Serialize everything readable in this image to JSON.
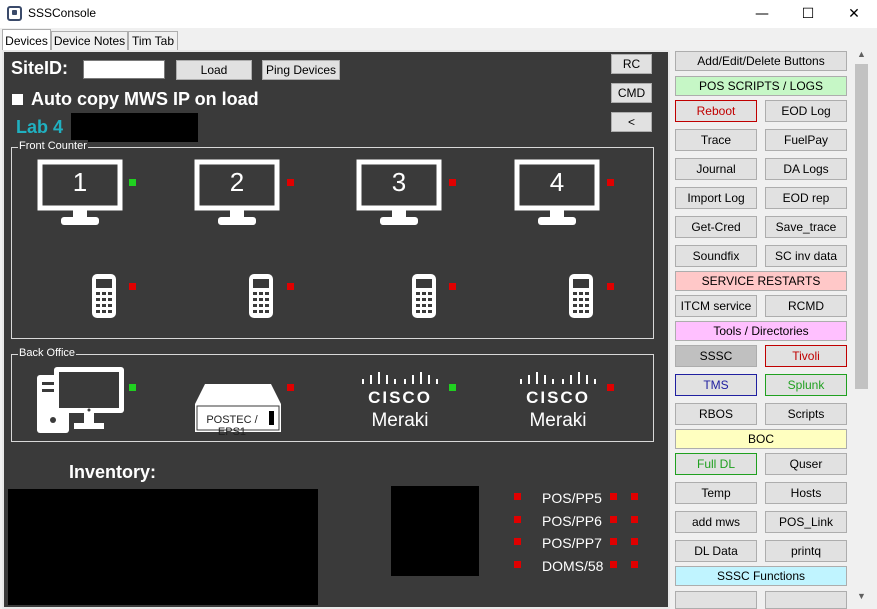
{
  "window": {
    "title": "SSSConsole",
    "minimize": "—",
    "maximize": "☐",
    "close": "✕"
  },
  "tabs": [
    {
      "label": "Devices"
    },
    {
      "label": "Device Notes"
    },
    {
      "label": "Tim Tab"
    }
  ],
  "devices": {
    "siteid_label": "SiteID:",
    "siteid_value": "",
    "load_button": "Load",
    "ping_button": "Ping Devices",
    "rc_button": "RC",
    "cmd_button": "CMD",
    "back_button": "<",
    "autocopy_label": "Auto copy MWS IP on load",
    "lab_label": "Lab 4",
    "front_counter_label": "Front Counter",
    "back_office_label": "Back Office",
    "monitors": [
      {
        "num": "1"
      },
      {
        "num": "2"
      },
      {
        "num": "3"
      },
      {
        "num": "4"
      }
    ],
    "postec_label": "POSTEC / EPS1",
    "cisco_text": "CISCO",
    "meraki_text": "Meraki",
    "inventory_label": "Inventory:",
    "pp_items": [
      {
        "label": "POS/PP5"
      },
      {
        "label": "POS/PP6"
      },
      {
        "label": "POS/PP7"
      },
      {
        "label": "DOMS/58"
      }
    ]
  },
  "colors": {
    "led_red": "#e00000",
    "led_green": "#20d020",
    "lab_cyan": "#20b0c0",
    "panel_dark": "#3a3a3a"
  },
  "right_panel": {
    "add_edit": "Add/Edit/Delete Buttons",
    "pos_scripts": "POS SCRIPTS / LOGS",
    "reboot": "Reboot",
    "eod_log": "EOD Log",
    "trace": "Trace",
    "fuelpay": "FuelPay",
    "journal": "Journal",
    "da_logs": "DA Logs",
    "import_log": "Import Log",
    "eod_rep": "EOD rep",
    "get_cred": "Get-Cred",
    "save_trace": "Save_trace",
    "soundfix": "Soundfix",
    "sc_inv": "SC inv data",
    "service_restarts": "SERVICE RESTARTS",
    "itcm": "ITCM service",
    "rcmd": "RCMD",
    "tools": "Tools / Directories",
    "sssc": "SSSC",
    "tivoli": "Tivoli",
    "tms": "TMS",
    "splunk": "Splunk",
    "rbos": "RBOS",
    "scripts": "Scripts",
    "boc": "BOC",
    "full_dl": "Full DL",
    "quser": "Quser",
    "temp": "Temp",
    "hosts": "Hosts",
    "add_mws": "add mws",
    "pos_link": "POS_Link",
    "dl_data": "DL Data",
    "printq": "printq",
    "sssc_functions": "SSSC Functions"
  }
}
